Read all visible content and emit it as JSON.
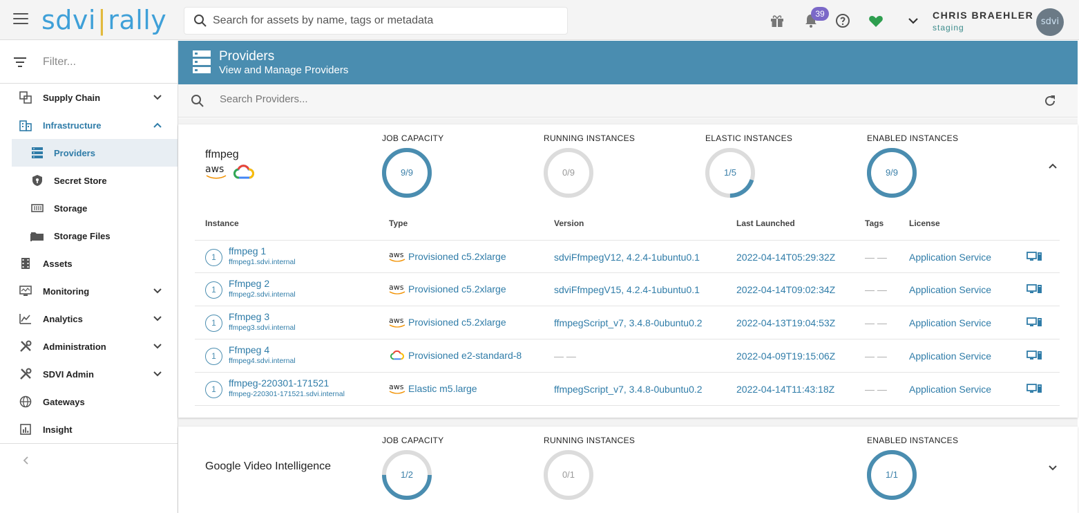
{
  "app": {
    "logo_left": "sdvi",
    "logo_sep": "|",
    "logo_right": "rally"
  },
  "topbar": {
    "search_placeholder": "Search for assets by name, tags or metadata",
    "notification_count": "39",
    "user_name": "CHRIS BRAEHLER",
    "user_env": "staging",
    "avatar_text": "sdvi"
  },
  "sidebar": {
    "filter_placeholder": "Filter...",
    "items": [
      {
        "label": "Supply Chain",
        "icon": "supply-chain-icon",
        "expandable": "down"
      },
      {
        "label": "Infrastructure",
        "icon": "building-icon",
        "expandable": "up"
      },
      {
        "label": "Providers",
        "icon": "server-icon"
      },
      {
        "label": "Secret Store",
        "icon": "shield-icon"
      },
      {
        "label": "Storage",
        "icon": "storage-icon"
      },
      {
        "label": "Storage Files",
        "icon": "folder-icon"
      },
      {
        "label": "Assets",
        "icon": "film-icon"
      },
      {
        "label": "Monitoring",
        "icon": "monitor-icon",
        "expandable": "down"
      },
      {
        "label": "Analytics",
        "icon": "analytics-icon",
        "expandable": "down"
      },
      {
        "label": "Administration",
        "icon": "tools-icon",
        "expandable": "down"
      },
      {
        "label": "SDVI Admin",
        "icon": "admin-tools-icon",
        "expandable": "down"
      },
      {
        "label": "Gateways",
        "icon": "globe-icon"
      },
      {
        "label": "Insight",
        "icon": "insight-icon"
      }
    ]
  },
  "header": {
    "title": "Providers",
    "subtitle": "View and Manage Providers"
  },
  "provider_search": {
    "placeholder": "Search Providers..."
  },
  "providers": [
    {
      "name": "ffmpeg",
      "logos": [
        "aws",
        "google-cloud"
      ],
      "stats": [
        {
          "label": "JOB CAPACITY",
          "value": "9/9",
          "fraction": 1.0
        },
        {
          "label": "RUNNING INSTANCES",
          "value": "0/9",
          "fraction": 0.0
        },
        {
          "label": "ELASTIC INSTANCES",
          "value": "1/5",
          "fraction": 0.2
        },
        {
          "label": "ENABLED INSTANCES",
          "value": "9/9",
          "fraction": 1.0
        }
      ],
      "columns": [
        "Instance",
        "Type",
        "Version",
        "Last Launched",
        "Tags",
        "License"
      ],
      "rows": [
        {
          "num": "1",
          "name": "ffmpeg 1",
          "host": "ffmpeg1.sdvi.internal",
          "type_logo": "aws",
          "type": "Provisioned c5.2xlarge",
          "version": "sdviFfmpegV12, 4.2.4-1ubuntu0.1",
          "launched": "2022-04-14T05:29:32Z",
          "tags": "— —",
          "license": "Application Service"
        },
        {
          "num": "1",
          "name": "Ffmpeg 2",
          "host": "ffmpeg2.sdvi.internal",
          "type_logo": "aws",
          "type": "Provisioned c5.2xlarge",
          "version": "sdviFfmpegV15, 4.2.4-1ubuntu0.1",
          "launched": "2022-04-14T09:02:34Z",
          "tags": "— —",
          "license": "Application Service"
        },
        {
          "num": "1",
          "name": "Ffmpeg 3",
          "host": "ffmpeg3.sdvi.internal",
          "type_logo": "aws",
          "type": "Provisioned c5.2xlarge",
          "version": "ffmpegScript_v7, 3.4.8-0ubuntu0.2",
          "launched": "2022-04-13T19:04:53Z",
          "tags": "— —",
          "license": "Application Service"
        },
        {
          "num": "1",
          "name": "Ffmpeg 4",
          "host": "ffmpeg4.sdvi.internal",
          "type_logo": "gcp",
          "type": "Provisioned e2-standard-8",
          "version": "— —",
          "launched": "2022-04-09T19:15:06Z",
          "tags": "— —",
          "license": "Application Service"
        },
        {
          "num": "1",
          "name": "ffmpeg-220301-171521",
          "host": "ffmpeg-220301-171521.sdvi.internal",
          "type_logo": "aws",
          "type": "Elastic m5.large",
          "version": "ffmpegScript_v7, 3.4.8-0ubuntu0.2",
          "launched": "2022-04-14T11:43:18Z",
          "tags": "— —",
          "license": "Application Service"
        }
      ]
    },
    {
      "name": "Google Video Intelligence",
      "stats": [
        {
          "label": "JOB CAPACITY",
          "value": "1/2",
          "fraction": 0.5
        },
        {
          "label": "RUNNING INSTANCES",
          "value": "0/1",
          "fraction": 0.0
        },
        {
          "label": "ENABLED INSTANCES",
          "value": "1/1",
          "fraction": 1.0
        }
      ]
    }
  ],
  "colors": {
    "accent": "#4a8db0",
    "link": "#2f7ca8",
    "badge": "#7b68c8",
    "heart": "#2e9e4f"
  }
}
